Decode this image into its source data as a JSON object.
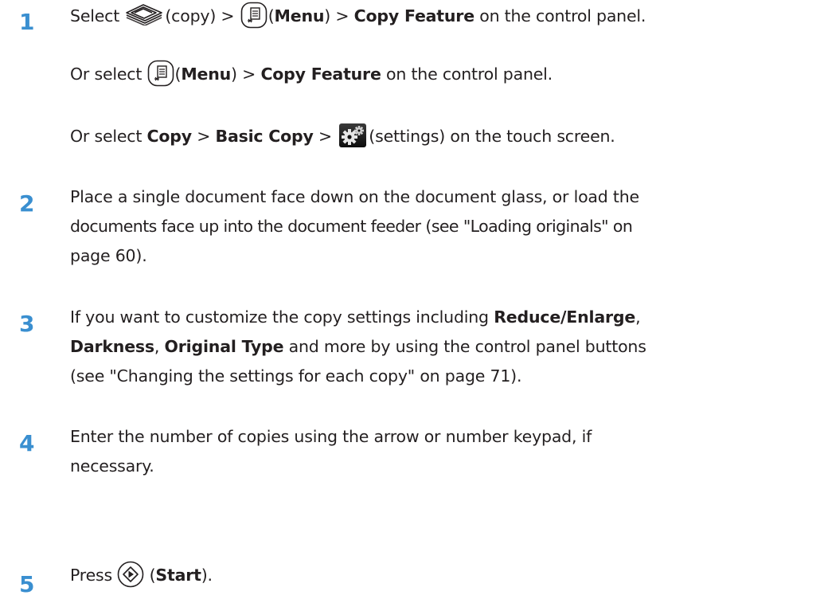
{
  "steps": [
    {
      "number": "1",
      "lines": [
        {
          "t1": "Select ",
          "t2": "(copy) > ",
          "t3": "(",
          "t4": "Menu",
          "t5": ") > ",
          "t6": "Copy Feature",
          "t7": " on the control panel."
        },
        {
          "t1": "Or select ",
          "t2": "(",
          "t3": "Menu",
          "t4": ") > ",
          "t5": "Copy Feature",
          "t6": " on the control panel."
        },
        {
          "t1": "Or select ",
          "t2": "Copy",
          "t3": " > ",
          "t4": "Basic Copy",
          "t5": "  > ",
          "t6": "(settings) on the touch screen."
        }
      ]
    },
    {
      "number": "2",
      "lines": [
        "Place a single document face down on the document glass, or load the",
        "documents face up into the document feeder (see \"Loading originals\" on",
        "page 60)."
      ]
    },
    {
      "number": "3",
      "lines": [
        {
          "t1": "If you want to customize the copy settings including ",
          "t2": "Reduce/Enlarge",
          "t3": ","
        },
        {
          "t1": "Darkness",
          "t2": ", ",
          "t3": "Original Type",
          "t4": " and more by using the control panel buttons"
        },
        "(see \"Changing the settings for each copy\" on page 71)."
      ]
    },
    {
      "number": "4",
      "lines": [
        "Enter the number of copies using the arrow or number keypad, if",
        "necessary."
      ]
    },
    {
      "number": "5",
      "lines": [
        {
          "t1": "Press ",
          "t2": " (",
          "t3": "Start",
          "t4": ")."
        }
      ]
    }
  ],
  "icons": [
    "copy-icon",
    "menu-icon",
    "settings-icon",
    "start-icon"
  ]
}
